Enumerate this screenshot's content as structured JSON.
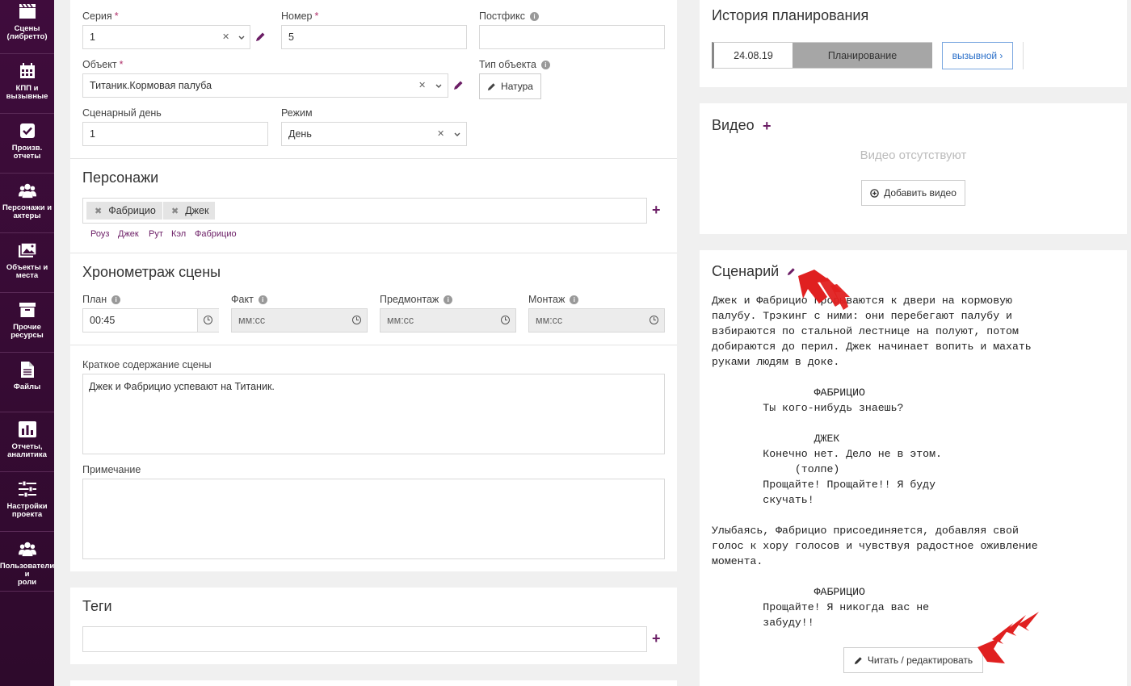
{
  "sidebar": {
    "items": [
      {
        "label": "Сцены\n(либретто)",
        "icon": "clapperboard-icon"
      },
      {
        "label": "КПП и\nвызывные",
        "icon": "calendar-icon"
      },
      {
        "label": "Произв.\nотчеты",
        "icon": "checkbox-icon"
      },
      {
        "label": "Персонажи и\nактеры",
        "icon": "users-icon"
      },
      {
        "label": "Объекты и\nместа",
        "icon": "image-icon"
      },
      {
        "label": "Прочие\nресурсы",
        "icon": "archive-icon"
      },
      {
        "label": "Файлы",
        "icon": "file-icon"
      },
      {
        "label": "Отчеты,\nаналитика",
        "icon": "bar-chart-icon"
      },
      {
        "label": "Настройки\nпроекта",
        "icon": "sliders-icon"
      },
      {
        "label": "Пользователи и\nроли",
        "icon": "users-icon"
      }
    ]
  },
  "form": {
    "series_label": "Серия",
    "series_value": "1",
    "number_label": "Номер",
    "number_value": "5",
    "postfix_label": "Постфикс",
    "postfix_value": "",
    "object_label": "Объект",
    "object_value": "Титаник.Кормовая палуба",
    "object_type_label": "Тип объекта",
    "object_type_button": "Натура",
    "script_day_label": "Сценарный день",
    "script_day_value": "1",
    "mode_label": "Режим",
    "mode_value": "День",
    "required_mark": "*",
    "info_glyph": "i"
  },
  "characters": {
    "heading": "Персонажи",
    "tags": [
      "Фабрицио",
      "Джек"
    ],
    "suggestions": [
      "Роуз",
      "Джек",
      "Рут",
      "Кэл",
      "Фабрицио"
    ]
  },
  "timing": {
    "heading": "Хронометраж сцены",
    "plan_label": "План",
    "plan_value": "00:45",
    "fact_label": "Факт",
    "fact_placeholder": "мм:сс",
    "premontage_label": "Предмонтаж",
    "premontage_placeholder": "мм:сс",
    "montage_label": "Монтаж",
    "montage_placeholder": "мм:сс"
  },
  "summary": {
    "label": "Краткое содержание сцены",
    "value": "Джек и Фабрицио успевают на Титаник.",
    "note_label": "Примечание",
    "note_value": ""
  },
  "tags_section": {
    "heading": "Теги"
  },
  "history": {
    "heading": "История планирования",
    "date": "24.08.19",
    "status": "Планирование",
    "callsheet_link": "вызывной ›"
  },
  "video": {
    "heading": "Видео",
    "empty_text": "Видео отсутствуют",
    "add_button": "Добавить видео"
  },
  "screenplay": {
    "heading": "Сценарий",
    "text": "Джек и Фабрицио прорываются к двери на кормовую\nпалубу. Трэкинг с ними: они перебегают палубу и\nвзбираются по стальной лестнице на полуют, потом\nдобираются до перил. Джек начинает вопить и махать\nруками людям в доке.\n\n                ФАБРИЦИО\n        Ты кого-нибудь знаешь?\n\n                ДЖЕК\n        Конечно нет. Дело не в этом.\n             (толпе)\n        Прощайте! Прощайте!! Я буду\n        скучать!\n\nУлыбаясь, Фабрицио присоединяется, добавляя свой\nголос к хору голосов и чувствуя радостное оживление\nмомента.\n\n                ФАБРИЦИО\n        Прощайте! Я никогда вас не\n        забуду!!",
    "edit_button": "Читать / редактировать"
  },
  "colors": {
    "sidebar_bg": "#3f0c3c",
    "accent": "#6b1d65",
    "arrow": "#e02020",
    "link": "#2a6fc9"
  }
}
